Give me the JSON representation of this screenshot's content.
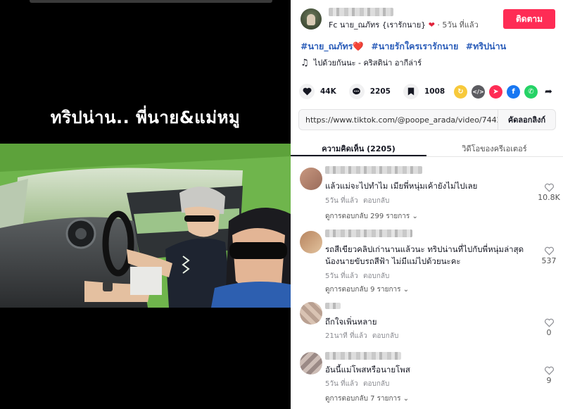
{
  "video": {
    "caption": "ทริปน่าน.. พี่นาย&แม่หมู"
  },
  "post": {
    "author_line": "Fc นาย_ณภัทร {เรารักนาย}",
    "posted_ago": "· 5วัน ที่แล้ว",
    "follow_label": "ติดตาม",
    "hashtags": [
      "#นาย_ณภัทร❤️",
      "#นายรักใครเรารักนาย",
      "#ทริปน่าน"
    ],
    "music": "ไปด้วยกันนะ - คริสติน่า อากีล่าร์",
    "stats": {
      "likes": "44K",
      "comments": "2205",
      "saves": "1008"
    },
    "link_url": "https://www.tiktok.com/@poope_arada/video/74422...",
    "copy_label": "คัดลอกลิงก์"
  },
  "tabs": [
    {
      "label": "ความคิดเห็น (2205)"
    },
    {
      "label": "วิดีโอของครีเอเตอร์"
    }
  ],
  "comments": [
    {
      "text": [
        "แล้วแม่จะไปทำไม เมียพี่หนุ่มเค้ายังไม่ไปเลย"
      ],
      "time": "5วัน ที่แล้ว",
      "reply": "ตอบกลับ",
      "replies": "ดูการตอบกลับ 299 รายการ",
      "likes": "10.8K"
    },
    {
      "text": [
        "รถสีเขียวคลิปเก่านานแล้วนะ ทริปน่านที่ไปกับพี่หนุ่มล่าสุด",
        "น้องนายขับรถสีฟ้า ไม่มีแม่ไปด้วยนะคะ"
      ],
      "time": "5วัน ที่แล้ว",
      "reply": "ตอบกลับ",
      "replies": "ดูการตอบกลับ 9 รายการ",
      "likes": "537"
    },
    {
      "text": [
        "ถึกใจเพิ่นหลาย"
      ],
      "time": "21นาที ที่แล้ว",
      "reply": "ตอบกลับ",
      "replies": "",
      "likes": "0"
    },
    {
      "text": [
        "อันนี้แม่โพสหรือนายโพส"
      ],
      "time": "5วัน ที่แล้ว",
      "reply": "ตอบกลับ",
      "replies": "ดูการตอบกลับ 7 รายการ",
      "likes": "9"
    }
  ],
  "colors": {
    "accent": "#fe2c55",
    "hashtag": "#2b5db9",
    "heart": "#e0243c"
  },
  "icons": [
    "heart-icon",
    "comment-icon",
    "bookmark-icon",
    "music-note-icon",
    "repost-icon",
    "embed-icon",
    "send-icon",
    "facebook-icon",
    "whatsapp-icon",
    "share-arrow-icon",
    "chevron-down-icon"
  ]
}
